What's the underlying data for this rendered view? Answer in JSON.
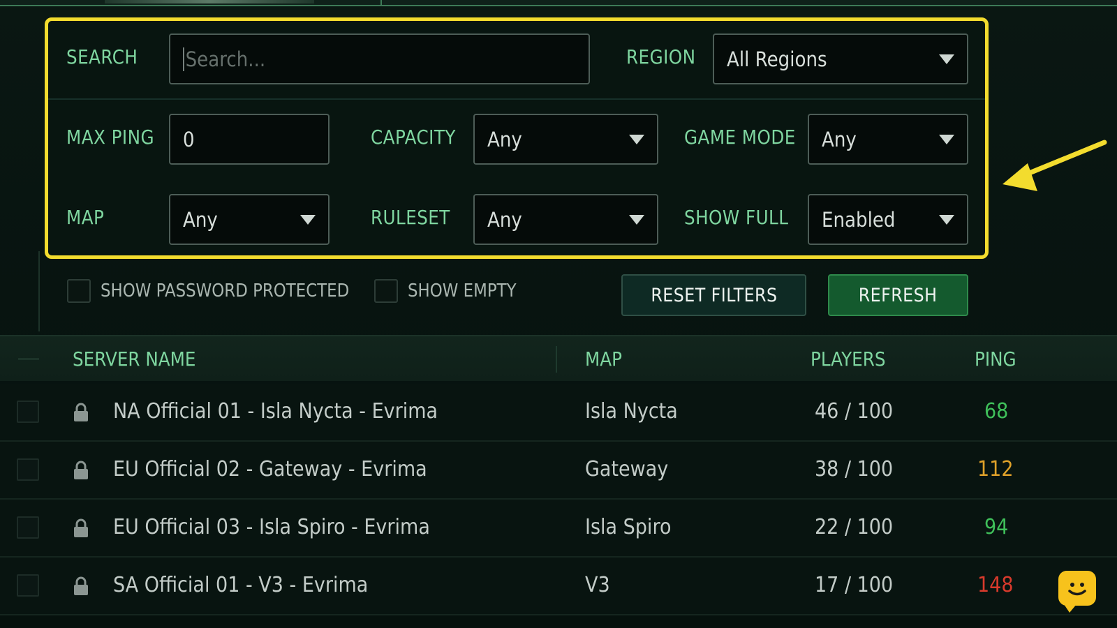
{
  "filters": {
    "search_label": "SEARCH",
    "search_placeholder": "Search...",
    "region_label": "REGION",
    "region_value": "All Regions",
    "max_ping_label": "MAX PING",
    "max_ping_value": "0",
    "capacity_label": "CAPACITY",
    "capacity_value": "Any",
    "game_mode_label": "GAME MODE",
    "game_mode_value": "Any",
    "map_label": "MAP",
    "map_value": "Any",
    "ruleset_label": "RULESET",
    "ruleset_value": "Any",
    "show_full_label": "SHOW FULL",
    "show_full_value": "Enabled"
  },
  "options": {
    "show_password_label": "SHOW PASSWORD PROTECTED",
    "show_password_checked": false,
    "show_empty_label": "SHOW EMPTY",
    "show_empty_checked": false,
    "reset_label": "RESET FILTERS",
    "refresh_label": "REFRESH"
  },
  "table": {
    "headers": {
      "server_name": "SERVER NAME",
      "map": "MAP",
      "players": "PLAYERS",
      "ping": "PING"
    },
    "rows": [
      {
        "name": "NA Official 01 - Isla Nycta - Evrima",
        "map": "Isla Nycta",
        "players": "46 / 100",
        "ping": "68",
        "ping_color": "#3fbf5a",
        "locked": true
      },
      {
        "name": "EU Official 02 - Gateway - Evrima",
        "map": "Gateway",
        "players": "38 / 100",
        "ping": "112",
        "ping_color": "#e0a22a",
        "locked": true
      },
      {
        "name": "EU Official 03 - Isla Spiro - Evrima",
        "map": "Isla Spiro",
        "players": "22 / 100",
        "ping": "94",
        "ping_color": "#3fbf5a",
        "locked": true
      },
      {
        "name": "SA Official 01 - V3 - Evrima",
        "map": "V3",
        "players": "17 / 100",
        "ping": "148",
        "ping_color": "#d83a2c",
        "locked": true
      }
    ]
  },
  "colors": {
    "accent": "#7fd6a0",
    "highlight": "#f3dc2e",
    "refresh_bg": "#145a2e"
  },
  "icons": {
    "lock": "lock-icon",
    "dropdown": "chevron-down-icon",
    "annotation_arrow": "arrow-icon",
    "chat": "chat-bubble-icon"
  }
}
